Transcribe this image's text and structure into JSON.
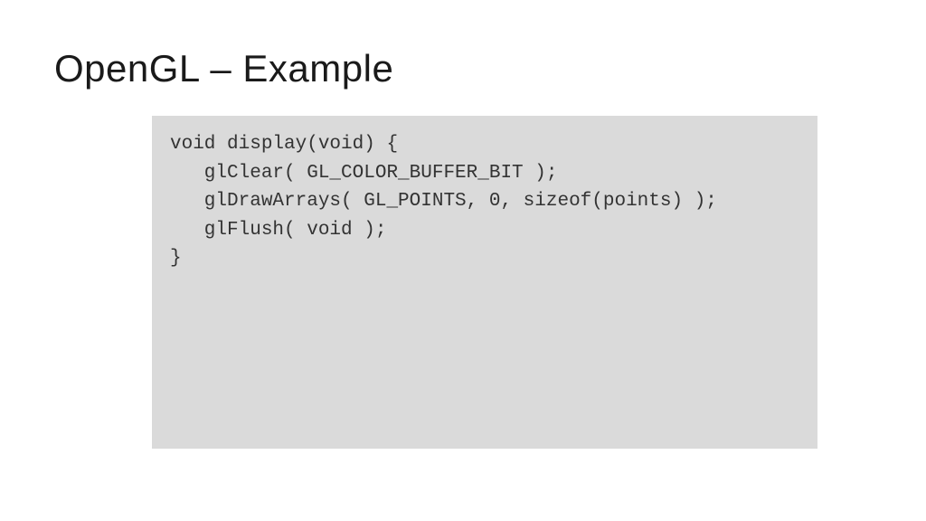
{
  "title": "OpenGL – Example",
  "code": {
    "lines": [
      "void display(void) {",
      "   glClear( GL_COLOR_BUFFER_BIT );",
      "   glDrawArrays( GL_POINTS, 0, sizeof(points) );",
      "   glFlush( void );",
      "}"
    ]
  }
}
